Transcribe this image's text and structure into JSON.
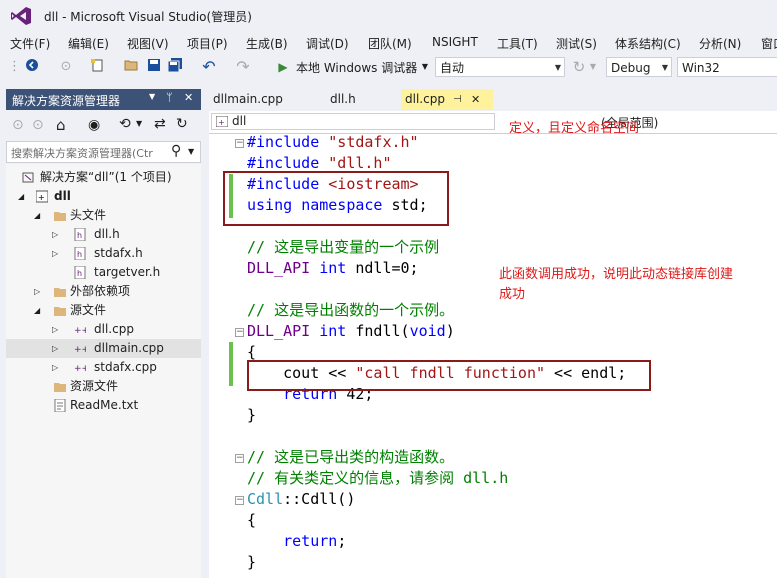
{
  "window": {
    "title": "dll - Microsoft Visual Studio(管理员)"
  },
  "menu": [
    "文件(F)",
    "编辑(E)",
    "视图(V)",
    "项目(P)",
    "生成(B)",
    "调试(D)",
    "团队(M)",
    "NSIGHT",
    "工具(T)",
    "测试(S)",
    "体系结构(C)",
    "分析(N)",
    "窗口"
  ],
  "toolbar": {
    "run_label": "本地 Windows 调试器",
    "run_mode": "自动",
    "configuration": "Debug",
    "platform": "Win32"
  },
  "solution_explorer": {
    "title": "解决方案资源管理器",
    "pin_glyph": "ᛘ",
    "close_glyph": "✕",
    "search_placeholder": "搜索解决方案资源管理器(Ctr",
    "tree": [
      {
        "label": "解决方案“dll”(1 个项目)"
      },
      {
        "label": "dll"
      },
      {
        "label": "头文件"
      },
      {
        "label": "dll.h"
      },
      {
        "label": "stdafx.h"
      },
      {
        "label": "targetver.h"
      },
      {
        "label": "外部依赖项"
      },
      {
        "label": "源文件"
      },
      {
        "label": "dll.cpp"
      },
      {
        "label": "dllmain.cpp"
      },
      {
        "label": "stdafx.cpp"
      },
      {
        "label": "资源文件"
      },
      {
        "label": "ReadMe.txt"
      }
    ]
  },
  "tabs": [
    {
      "label": "dllmain.cpp",
      "active": false
    },
    {
      "label": "dll.h",
      "active": false
    },
    {
      "label": "dll.cpp",
      "active": true
    }
  ],
  "tab_pin_glyph": "⊣",
  "tab_close_glyph": "✕",
  "nav": {
    "scope": "dll",
    "member": "(全局范围)"
  },
  "code": [
    "#include \"stdafx.h\"",
    "#include \"dll.h\"",
    "#include <iostream>",
    "using namespace std;",
    "",
    "// 这是导出变量的一个示例",
    "DLL_API int ndll=0;",
    "",
    "// 这是导出函数的一个示例。",
    "DLL_API int fndll(void)",
    "{",
    "    cout << \"call fndll function\" << endl;",
    "    return 42;",
    "}",
    "",
    "// 这是已导出类的构造函数。",
    "// 有关类定义的信息，请参阅 dll.h",
    "Cdll::Cdll()",
    "{",
    "    return;",
    "}"
  ],
  "annotations": {
    "top": "定义，且定义命名空间",
    "middle_line1": "此函数调用成功，说明此动态链接库创建",
    "middle_line2": "成功"
  },
  "colors": {
    "titlebar_bg": "#eef0f5",
    "panel_header": "#3d5277",
    "active_tab": "#fff29d",
    "keyword": "#0000ff",
    "string": "#a31515",
    "comment": "#008000",
    "macro": "#6f008a",
    "annotation_red": "#e01818",
    "box_red": "#8b1a1a"
  }
}
